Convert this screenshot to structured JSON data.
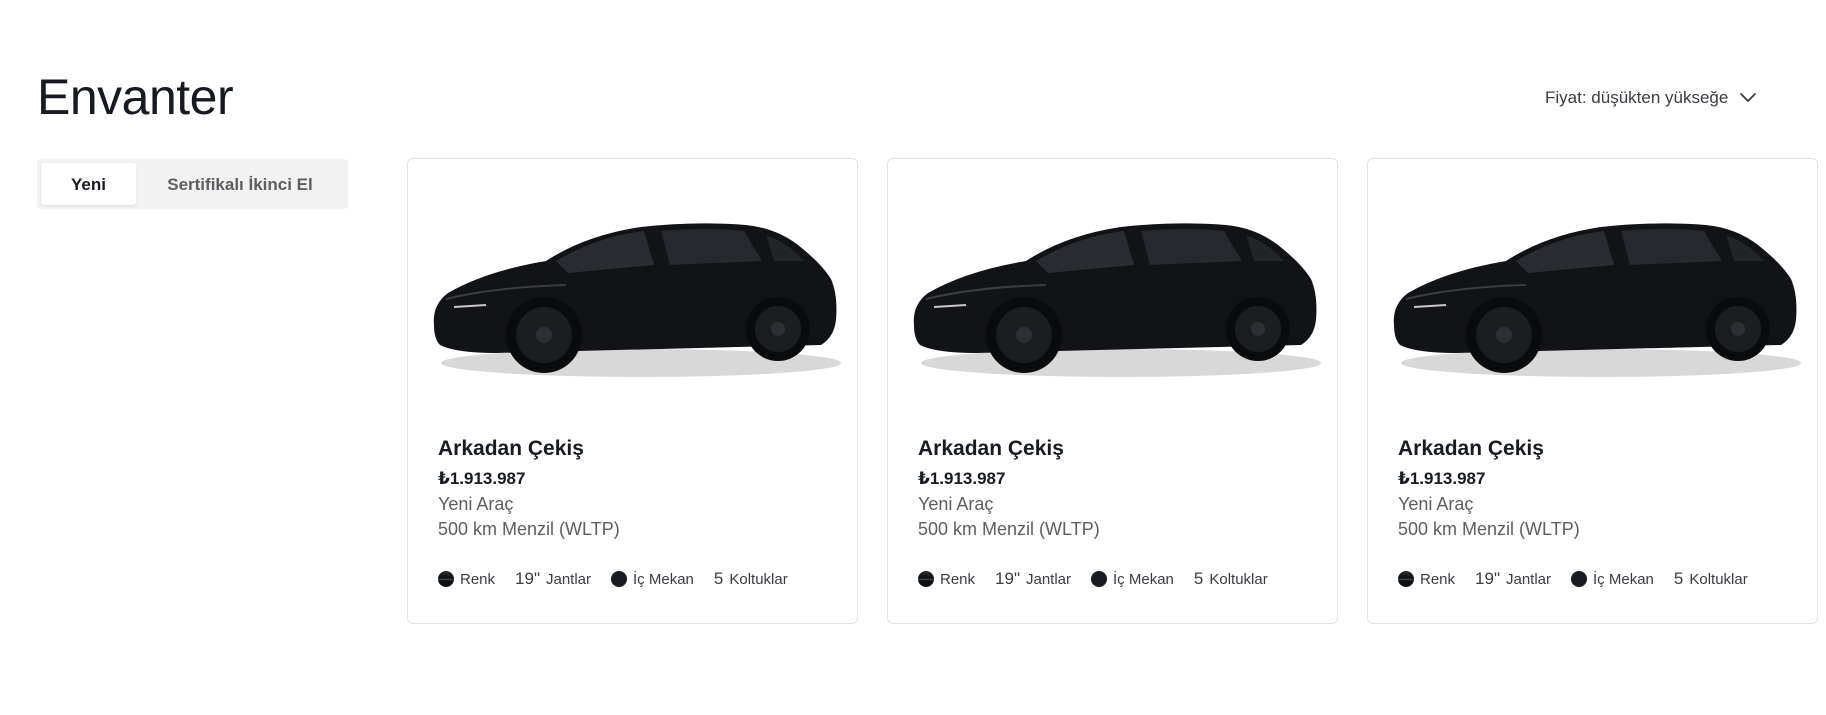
{
  "header": {
    "title": "Envanter",
    "sort_label": "Fiyat: düşükten yükseğe"
  },
  "tabs": [
    {
      "label": "Yeni",
      "active": true
    },
    {
      "label": "Sertifikalı İkinci El",
      "active": false
    }
  ],
  "cards": [
    {
      "title": "Arkadan Çekiş",
      "price": "₺1.913.987",
      "condition": "Yeni Araç",
      "range": "500 km Menzil (WLTP)",
      "specs": {
        "color": "Renk",
        "wheels_num": "19\"",
        "wheels": "Jantlar",
        "interior": "İç Mekan",
        "seats_num": "5",
        "seats": "Koltuklar"
      }
    },
    {
      "title": "Arkadan Çekiş",
      "price": "₺1.913.987",
      "condition": "Yeni Araç",
      "range": "500 km Menzil (WLTP)",
      "specs": {
        "color": "Renk",
        "wheels_num": "19\"",
        "wheels": "Jantlar",
        "interior": "İç Mekan",
        "seats_num": "5",
        "seats": "Koltuklar"
      }
    },
    {
      "title": "Arkadan Çekiş",
      "price": "₺1.913.987",
      "condition": "Yeni Araç",
      "range": "500 km Menzil (WLTP)",
      "specs": {
        "color": "Renk",
        "wheels_num": "19\"",
        "wheels": "Jantlar",
        "interior": "İç Mekan",
        "seats_num": "5",
        "seats": "Koltuklar"
      }
    }
  ],
  "colors": {
    "text_primary": "#171a20",
    "text_secondary": "#5c5e62",
    "tab_bg": "#f2f2f2",
    "card_border": "#e4e4e4",
    "paint": "#0d0e10"
  },
  "icons": {
    "sort": "chevron-down-icon",
    "paint": "paint-swatch-icon",
    "interior": "interior-swatch-icon"
  }
}
